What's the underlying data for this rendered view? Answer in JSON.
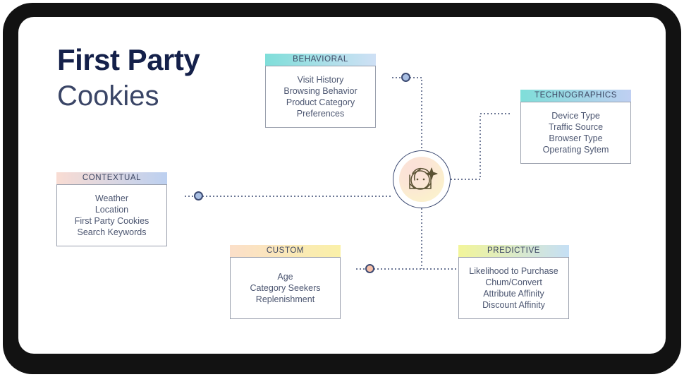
{
  "title": {
    "line1": "First Party",
    "line2": "Cookies"
  },
  "hub": {
    "icon": "customer-profile-sparkle-icon",
    "gradient_start": "#fbe0d8",
    "gradient_end": "#fcf3d4",
    "ring_color": "#3c4a72"
  },
  "colors": {
    "title_primary": "#14204a",
    "title_secondary": "#3a4566",
    "body_text": "#4c5671",
    "card_border": "#9aa0ad",
    "connector": "#3c4a72",
    "canvas_bg": "#ffffff",
    "bezel": "#121212"
  },
  "categories": [
    {
      "id": "behavioral",
      "label": "BEHAVIORAL",
      "header_gradient_start": "#7fded9",
      "header_gradient_end": "#cfe0f5",
      "node_color": "#a9bfe3",
      "items": [
        "Visit History",
        "Browsing Behavior",
        "Product Category",
        "Preferences"
      ]
    },
    {
      "id": "technographics",
      "label": "TECHNOGRAPHICS",
      "header_gradient_start": "#7fded9",
      "header_gradient_end": "#bfcff2",
      "node_color": "#3fd9cf",
      "items": [
        "Device Type",
        "Traffic Source",
        "Browser Type",
        "Operating Sytem"
      ]
    },
    {
      "id": "contextual",
      "label": "CONTEXTUAL",
      "header_gradient_start": "#f9dcd3",
      "header_gradient_end": "#bcd0f0",
      "node_color": "#a9bfe3",
      "items": [
        "Weather",
        "Location",
        "First Party Cookies",
        "Search Keywords"
      ]
    },
    {
      "id": "custom",
      "label": "CUSTOM",
      "header_gradient_start": "#fbdfc9",
      "header_gradient_end": "#faf0a8",
      "node_color": "#f7c0a8",
      "items": [
        "Age",
        "Category Seekers",
        "Replenishment"
      ]
    },
    {
      "id": "predictive",
      "label": "PREDICTIVE",
      "header_gradient_start": "#f2f59a",
      "header_gradient_end": "#c5dff5",
      "node_color": "#eded3c",
      "items": [
        "Likelihood to Purchase",
        "Chum/Convert",
        "Attribute Affinity",
        "Discount Affinity"
      ]
    }
  ]
}
